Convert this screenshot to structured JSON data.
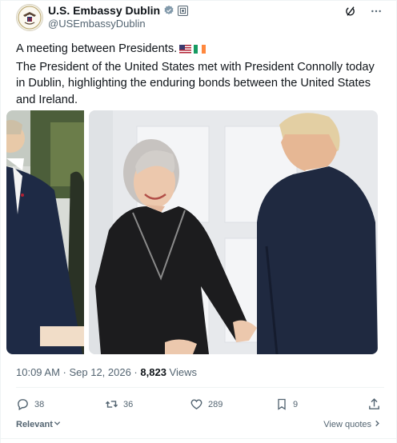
{
  "account": {
    "display_name": "U.S. Embassy Dublin",
    "handle": "@USEmbassyDublin",
    "verified_color": "#829aab"
  },
  "tweet": {
    "line1": "A meeting between Presidents.",
    "line2": "The President of the United States met with President Connolly today in Dublin, highlighting the enduring bonds between the United States and Ireland."
  },
  "meta": {
    "time": "10:09 AM · Sep 12, 2026 · ",
    "views_count": "8,823",
    "views_label": " Views"
  },
  "actions": {
    "replies": "38",
    "reposts": "36",
    "likes": "289",
    "bookmarks": "9"
  },
  "footer": {
    "sort_label": "Relevant",
    "view_quotes": "View quotes"
  },
  "colors": {
    "text": "#0f1419",
    "secondary": "#536471",
    "border": "#eff3f4"
  },
  "icons": [
    "grok-icon",
    "more-icon",
    "reply-icon",
    "repost-icon",
    "like-icon",
    "bookmark-icon",
    "share-icon",
    "affiliate-badge-icon",
    "verified-badge-icon"
  ]
}
